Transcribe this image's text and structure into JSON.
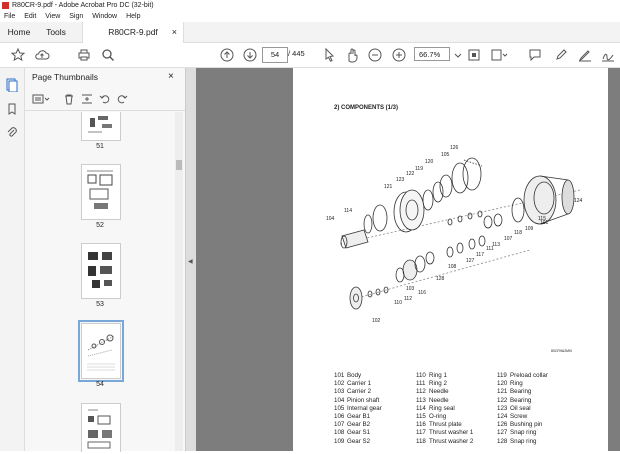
{
  "window": {
    "title": "R80CR-9.pdf - Adobe Acrobat Pro DC (32-bit)"
  },
  "menu": [
    "File",
    "Edit",
    "View",
    "Sign",
    "Window",
    "Help"
  ],
  "tabs": {
    "home": "Home",
    "tools": "Tools",
    "doc": "R80CR-9.pdf",
    "close": "×"
  },
  "toolbar": {
    "page_current": "54",
    "page_total": "/ 445",
    "zoom": "66.7%"
  },
  "panel": {
    "title": "Page Thumbnails",
    "close": "×"
  },
  "thumbnails": [
    {
      "label": "51"
    },
    {
      "label": "52"
    },
    {
      "label": "53"
    },
    {
      "label": "54"
    }
  ],
  "page": {
    "section_title": "2) COMPONENTS (1/3)",
    "figure_id": "80CR9A2MI0",
    "callouts": [
      "126",
      "105",
      "120",
      "119",
      "122",
      "123",
      "121",
      "114",
      "104",
      "102",
      "103",
      "112",
      "110",
      "111",
      "113",
      "117",
      "116",
      "115",
      "108",
      "109",
      "107",
      "118",
      "127",
      "124",
      "101",
      "128"
    ],
    "parts_col1": [
      {
        "no": "101",
        "name": "Body"
      },
      {
        "no": "102",
        "name": "Carrier 1"
      },
      {
        "no": "103",
        "name": "Carrier 2"
      },
      {
        "no": "104",
        "name": "Pinion shaft"
      },
      {
        "no": "105",
        "name": "Internal gear"
      },
      {
        "no": "106",
        "name": "Gear B1"
      },
      {
        "no": "107",
        "name": "Gear B2"
      },
      {
        "no": "108",
        "name": "Gear S1"
      },
      {
        "no": "109",
        "name": "Gear S2"
      }
    ],
    "parts_col2": [
      {
        "no": "110",
        "name": "Ring 1"
      },
      {
        "no": "111",
        "name": "Ring 2"
      },
      {
        "no": "112",
        "name": "Needle"
      },
      {
        "no": "113",
        "name": "Needle"
      },
      {
        "no": "114",
        "name": "Ring seal"
      },
      {
        "no": "115",
        "name": "O-ring"
      },
      {
        "no": "116",
        "name": "Thrust plate"
      },
      {
        "no": "117",
        "name": "Thrust washer 1"
      },
      {
        "no": "118",
        "name": "Thrust washer 2"
      }
    ],
    "parts_col3": [
      {
        "no": "119",
        "name": "Preload collar"
      },
      {
        "no": "120",
        "name": "Ring"
      },
      {
        "no": "121",
        "name": "Bearing"
      },
      {
        "no": "122",
        "name": "Bearing"
      },
      {
        "no": "123",
        "name": "Oil seal"
      },
      {
        "no": "124",
        "name": "Screw"
      },
      {
        "no": "126",
        "name": "Bushing pin"
      },
      {
        "no": "127",
        "name": "Snap ring"
      },
      {
        "no": "128",
        "name": "Snap ring"
      }
    ]
  }
}
